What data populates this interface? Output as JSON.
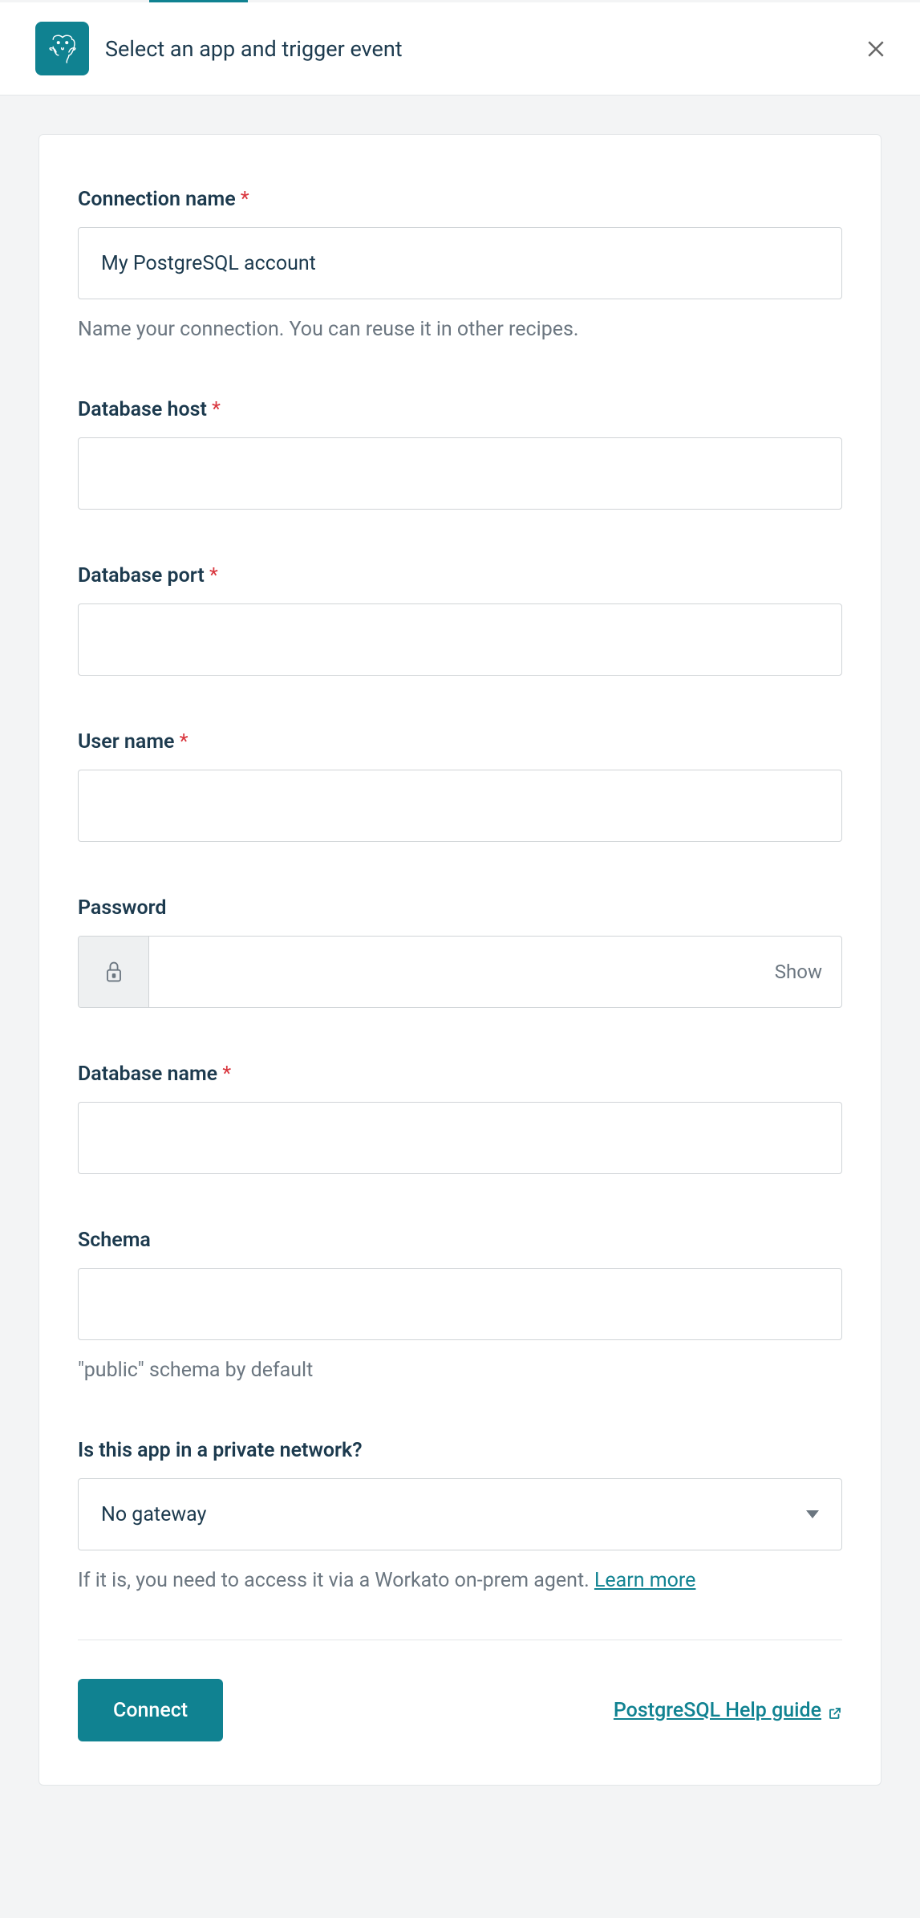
{
  "header": {
    "title": "Select an app and trigger event",
    "app_icon_name": "postgresql-elephant-icon"
  },
  "form": {
    "connection_name": {
      "label": "Connection name",
      "required": true,
      "value": "My PostgreSQL account",
      "help": "Name your connection. You can reuse it in other recipes."
    },
    "db_host": {
      "label": "Database host",
      "required": true,
      "value": ""
    },
    "db_port": {
      "label": "Database port",
      "required": true,
      "value": ""
    },
    "username": {
      "label": "User name",
      "required": true,
      "value": ""
    },
    "password": {
      "label": "Password",
      "required": false,
      "value": "",
      "show_label": "Show"
    },
    "db_name": {
      "label": "Database name",
      "required": true,
      "value": ""
    },
    "schema": {
      "label": "Schema",
      "required": false,
      "value": "",
      "help": "\"public\" schema by default"
    },
    "private_network": {
      "label": "Is this app in a private network?",
      "required": false,
      "value": "No gateway",
      "help_prefix": "If it is, you need to access it via a Workato on-prem agent. ",
      "learn_more": "Learn more"
    }
  },
  "footer": {
    "connect_button": "Connect",
    "help_link": "PostgreSQL Help guide"
  },
  "colors": {
    "accent": "#108291",
    "text": "#1C3A4E",
    "muted": "#6B7680",
    "required": "#D9363E"
  }
}
